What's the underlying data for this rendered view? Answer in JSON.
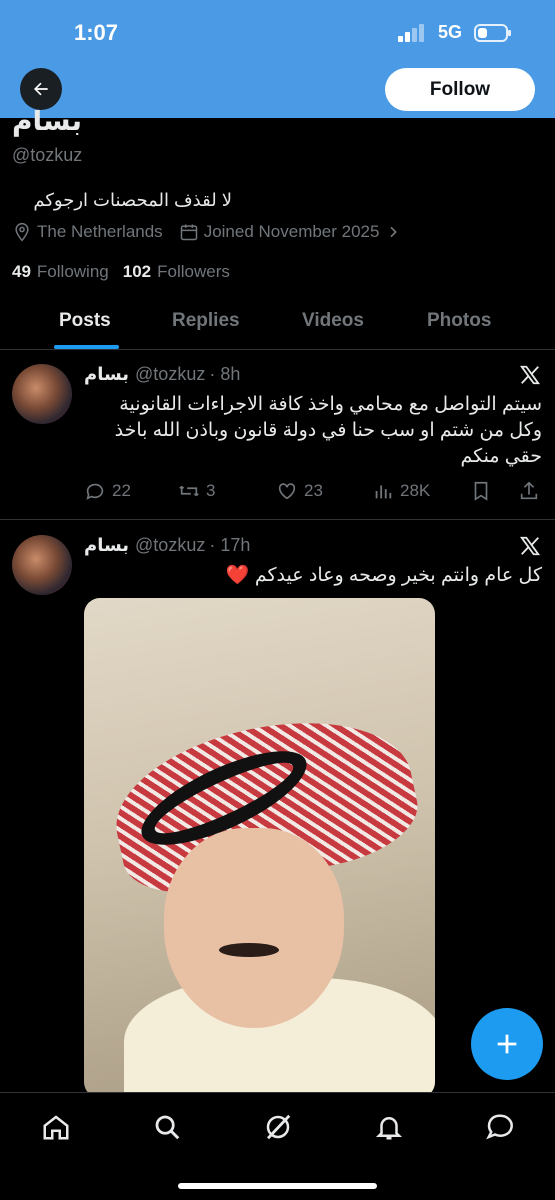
{
  "status_bar": {
    "time": "1:07",
    "network": "5G",
    "battery_level": 0.35
  },
  "header": {
    "follow_label": "Follow"
  },
  "profile": {
    "name": "بسام",
    "handle": "@tozkuz",
    "bio": "لا لقذف المحصنات ارجوكم",
    "location": "The Netherlands",
    "joined": "Joined November 2025",
    "following_count": "49",
    "following_label": "Following",
    "followers_count": "102",
    "followers_label": "Followers"
  },
  "tabs": [
    {
      "label": "Posts",
      "active": true
    },
    {
      "label": "Replies",
      "active": false
    },
    {
      "label": "Videos",
      "active": false
    },
    {
      "label": "Photos",
      "active": false
    }
  ],
  "posts": [
    {
      "name": "بسام",
      "handle": "@tozkuz",
      "time": "· 8h",
      "text": "سيتم التواصل مع محامي واخذ كافة الاجراءات القانونية وكل من شتم او سب حنا في دولة قانون وباذن الله باخذ حقي منكم",
      "replies": "22",
      "reposts": "3",
      "likes": "23",
      "views": "28K"
    },
    {
      "name": "بسام",
      "handle": "@tozkuz",
      "time": "· 17h",
      "text": "كل عام وانتم بخير وصحه وعاد عيدكم ❤️"
    }
  ],
  "colors": {
    "banner": "#4b9ae5",
    "accent": "#1d9bf0",
    "background": "#000000"
  },
  "icons": [
    "back-arrow-icon",
    "location-pin-icon",
    "calendar-icon",
    "chevron-right-icon",
    "x-logo-icon",
    "reply-icon",
    "repost-icon",
    "like-icon",
    "views-icon",
    "bookmark-icon",
    "share-icon",
    "compose-plus-icon",
    "home-icon",
    "search-icon",
    "grok-icon",
    "notifications-icon",
    "messages-icon"
  ]
}
